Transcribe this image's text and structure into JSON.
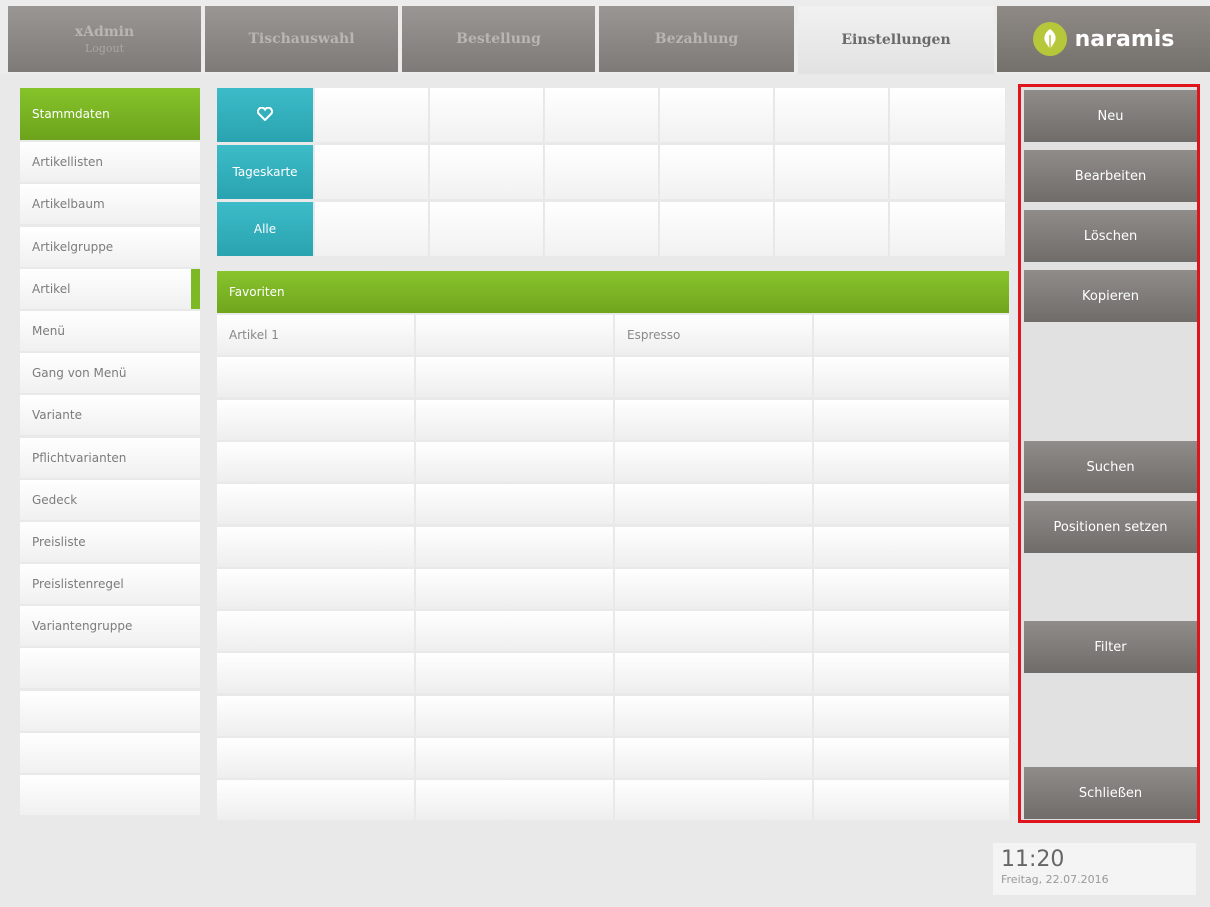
{
  "header": {
    "user": {
      "name": "xAdmin",
      "sub": "Logout"
    },
    "tabs": [
      {
        "label": "Tischauswahl"
      },
      {
        "label": "Bestellung"
      },
      {
        "label": "Bezahlung"
      },
      {
        "label": "Einstellungen",
        "active": true
      }
    ],
    "logo": {
      "text": "naramis",
      "icon": "leaf-icon"
    }
  },
  "sidebar": {
    "items": [
      {
        "label": "Stammdaten",
        "style": "green"
      },
      {
        "label": "Artikellisten"
      },
      {
        "label": "Artikelbaum"
      },
      {
        "label": "Artikelgruppe"
      },
      {
        "label": "Artikel",
        "selected": true
      },
      {
        "label": "Menü"
      },
      {
        "label": "Gang von Menü"
      },
      {
        "label": "Variante"
      },
      {
        "label": "Pflichtvarianten"
      },
      {
        "label": "Gedeck"
      },
      {
        "label": "Preisliste"
      },
      {
        "label": "Preislistenregel"
      },
      {
        "label": "Variantengruppe"
      },
      {
        "label": ""
      },
      {
        "label": ""
      },
      {
        "label": ""
      },
      {
        "label": ""
      }
    ]
  },
  "categories": {
    "buttons": [
      {
        "icon": "heart-icon",
        "label": ""
      },
      {
        "label": "Tageskarte"
      },
      {
        "label": "Alle"
      }
    ]
  },
  "favorites": {
    "title": "Favoriten",
    "cells": [
      [
        "Artikel 1",
        "",
        "Espresso",
        ""
      ]
    ]
  },
  "actions": {
    "new": "Neu",
    "edit": "Bearbeiten",
    "delete": "Löschen",
    "copy": "Kopieren",
    "search": "Suchen",
    "positions": "Positionen setzen",
    "filter": "Filter",
    "close": "Schließen"
  },
  "clock": {
    "time": "11:20",
    "date": "Freitag, 22.07.2016"
  },
  "colors": {
    "accent_green": "#7cb924",
    "teal": "#2fb0bd",
    "highlight_border": "#e0141d"
  }
}
